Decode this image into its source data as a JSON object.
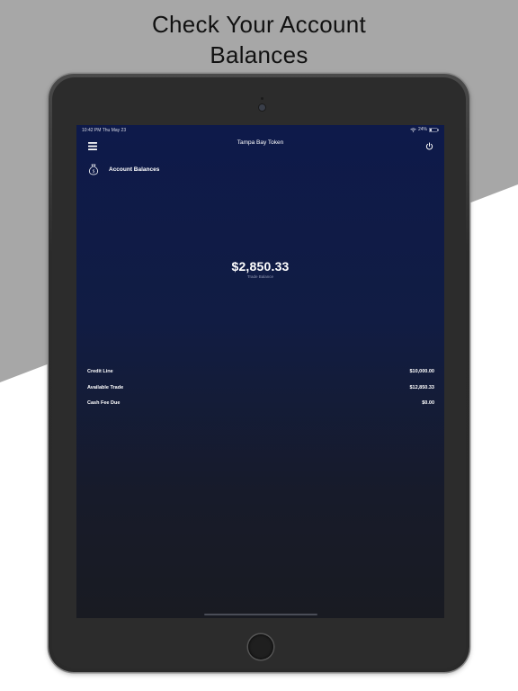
{
  "headline": {
    "line1": "Check Your Account",
    "line2": "Balances"
  },
  "status_bar": {
    "time_date": "10:42 PM  Thu May 23",
    "battery": "24%"
  },
  "navbar": {
    "title": "Tampa Bay Token"
  },
  "section": {
    "label": "Account Balances"
  },
  "balance": {
    "amount": "$2,850.33",
    "caption": "Trade Balance"
  },
  "details": [
    {
      "label": "Credit Line",
      "value": "$10,000.00"
    },
    {
      "label": "Available Trade",
      "value": "$12,850.33"
    },
    {
      "label": "Cash Fee Due",
      "value": "$0.00"
    }
  ],
  "icons": {
    "menu": "hamburger-menu-icon",
    "power": "power-icon",
    "section": "money-bag-icon",
    "wifi": "wifi-icon",
    "battery": "battery-icon"
  },
  "colors": {
    "screen_top": "#0e1a4a",
    "screen_bottom": "#191b22",
    "caption": "#8c93ad"
  }
}
